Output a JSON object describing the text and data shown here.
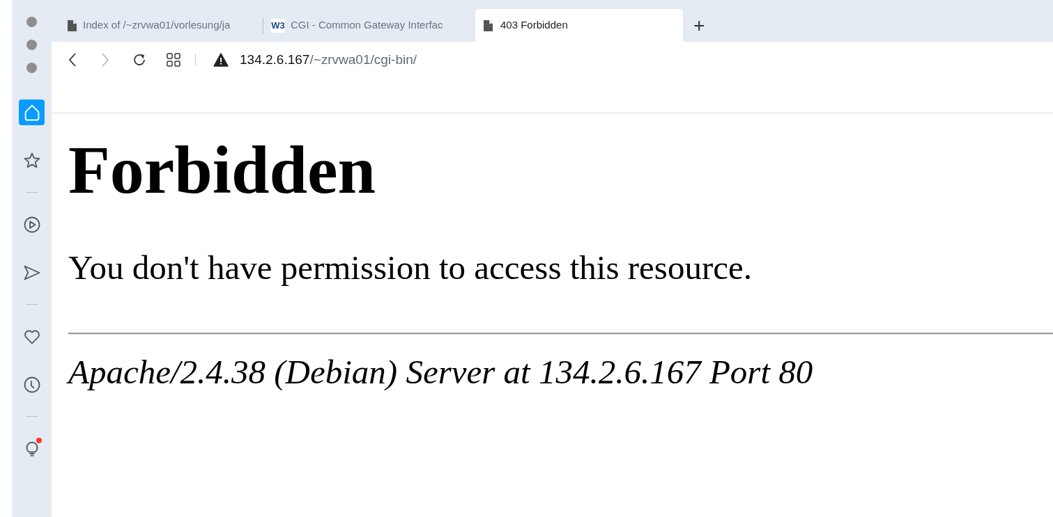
{
  "tabs": [
    {
      "title": "Index of /~zrvwa01/vorlesung/ja",
      "kind": "document",
      "selected": false
    },
    {
      "title": "CGI - Common Gateway Interfac",
      "kind": "logo",
      "favicon": "W3",
      "selected": false
    },
    {
      "title": "403 Forbidden",
      "kind": "document",
      "selected": true
    }
  ],
  "new_tab": "+",
  "address_bar": {
    "host": "134.2.6.167",
    "path": "/~zrvwa01/cgi-bin/",
    "insecure": true
  },
  "sidebar": {
    "items": [
      {
        "kind": "home",
        "selected": true
      },
      {
        "kind": "star",
        "selected": false
      },
      {
        "kind": "separator"
      },
      {
        "kind": "play",
        "selected": false
      },
      {
        "kind": "send",
        "selected": false
      },
      {
        "kind": "separator"
      },
      {
        "kind": "heart",
        "selected": false
      },
      {
        "kind": "clock",
        "selected": false
      },
      {
        "kind": "separator"
      },
      {
        "kind": "bulb",
        "selected": false,
        "notification": true
      }
    ]
  },
  "page": {
    "heading": "Forbidden",
    "message": "You don't have permission to access this resource.",
    "address": "Apache/2.4.38 (Debian) Server at 134.2.6.167 Port 80"
  }
}
